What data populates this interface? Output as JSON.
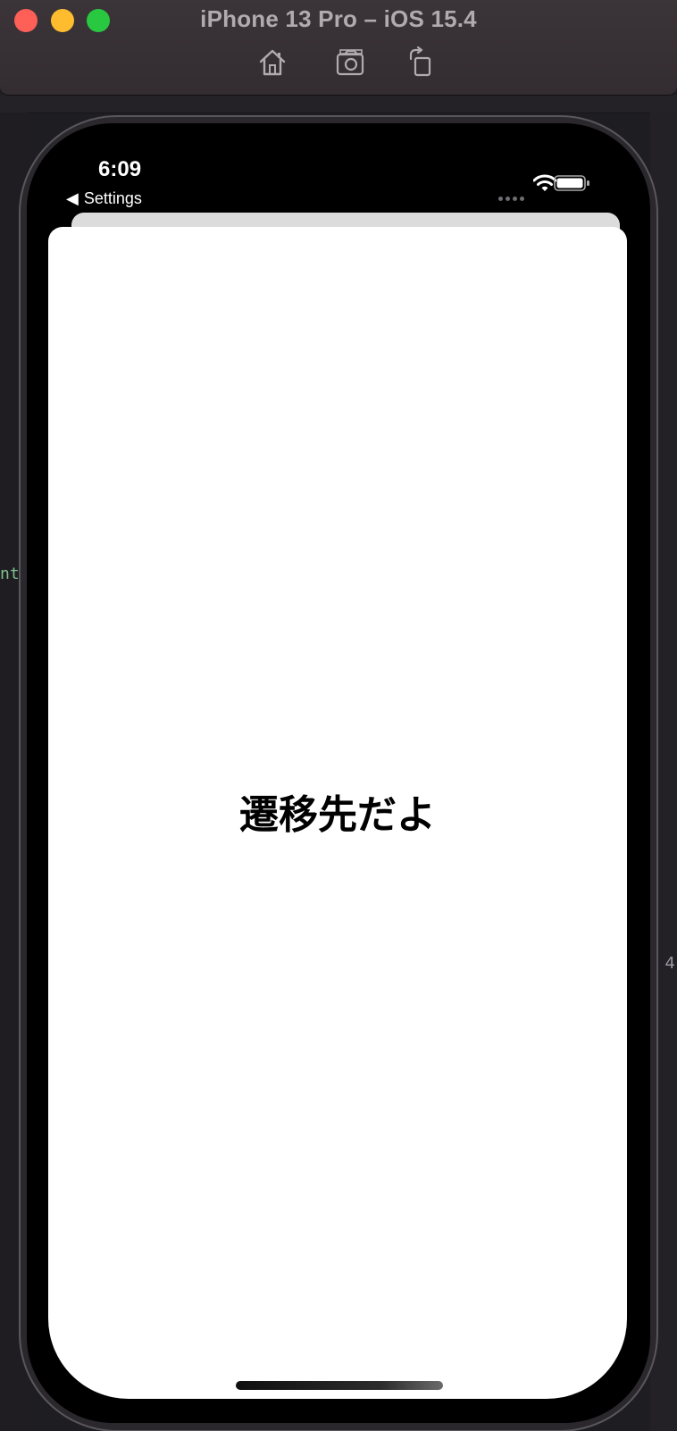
{
  "window": {
    "title": "iPhone 13 Pro – iOS 15.4",
    "toolbar": [
      "home-icon",
      "screenshot-icon",
      "rotate-icon"
    ]
  },
  "status_bar": {
    "time": "6:09",
    "back_label": "Settings",
    "icons": [
      "cellular-dots-icon",
      "wifi-icon",
      "battery-icon"
    ]
  },
  "sheet": {
    "title": "遷移先だよ"
  },
  "background": {
    "left_snippet": "nt",
    "right_snippet": "4"
  },
  "colors": {
    "close": "#fe5f57",
    "minimize": "#febc2e",
    "maximize": "#28c840",
    "sheet_bg": "#ffffff",
    "device_bg": "#000000"
  }
}
